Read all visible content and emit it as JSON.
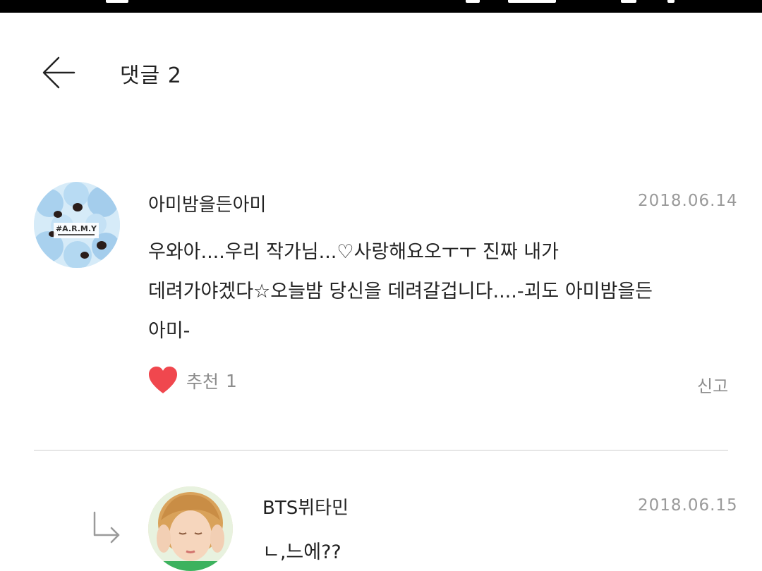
{
  "header": {
    "title": "댓글 2"
  },
  "comments": [
    {
      "author": "아미밤을든아미",
      "date": "2018.06.14",
      "lines": [
        "우와아....우리 작가님...♡사랑해요오ㅜㅜ 진짜 내가",
        "데려가야겠다☆오늘밤 당신을 데려갈겁니다....-괴도 아미밤을든",
        "아미-"
      ],
      "avatar_text": "#A.R.M.Y",
      "like_label": "추천",
      "like_count": "1",
      "report_label": "신고"
    },
    {
      "author": "BTS뷔타민",
      "date": "2018.06.15",
      "lines": [
        "ㄴ,느에??"
      ]
    }
  ],
  "icons": {
    "back": "arrow-left-icon",
    "like": "heart-icon",
    "reply": "reply-arrow-icon"
  },
  "colors": {
    "heart": "#f0474e",
    "muted": "#8c8c8c",
    "divider": "#e6e6e6"
  }
}
